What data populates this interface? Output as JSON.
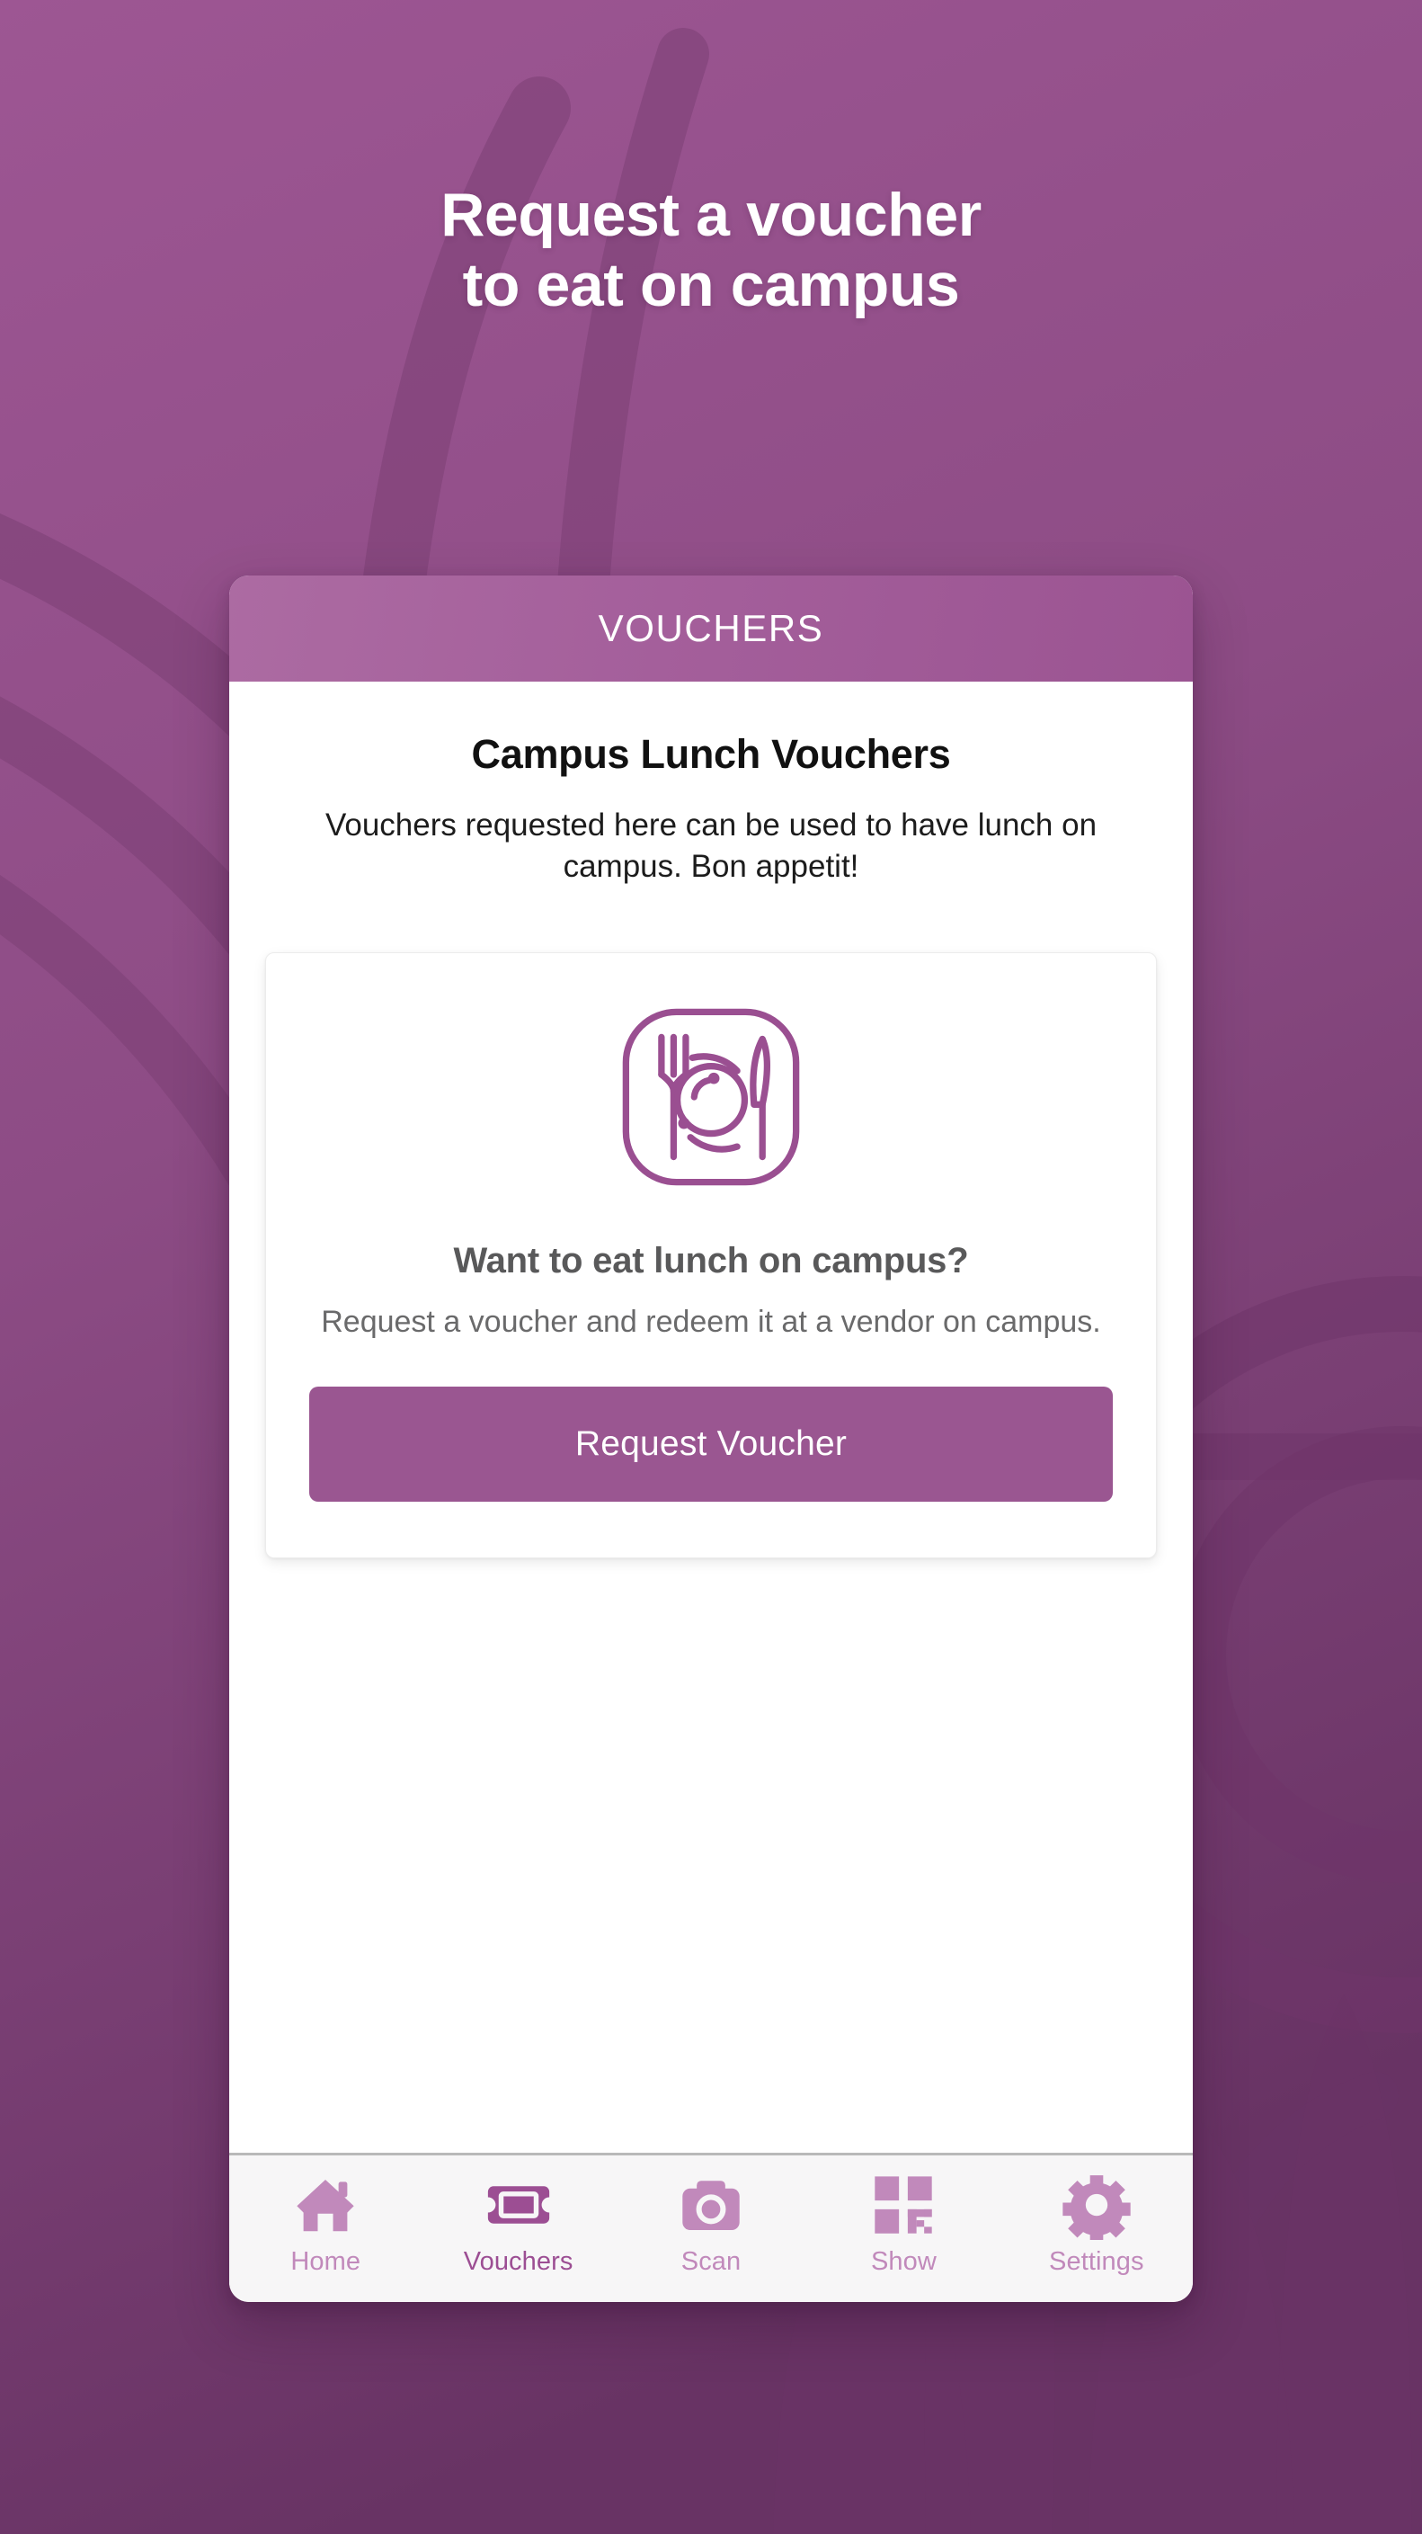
{
  "theme": {
    "brand_purple": "#9a5691",
    "header_gradient_light": "#ac6ba2",
    "header_gradient_dark": "#9b5492",
    "background_purple": "#8c4b84",
    "nav_inactive": "#c189bb",
    "nav_active": "#9c4e93",
    "card_white": "#ffffff",
    "nav_bar_bg": "#f7f6f7"
  },
  "heading": {
    "line1": "Request a voucher",
    "line2": "to eat on campus"
  },
  "card": {
    "header_title": "VOUCHERS",
    "section_title": "Campus Lunch Vouchers",
    "section_description": "Vouchers requested here can be used to have lunch on campus. Bon appetit!"
  },
  "inner_card": {
    "icon": "meal-plate-fork-knife-icon",
    "cta_title": "Want to eat lunch on campus?",
    "cta_description": "Request a voucher and redeem it at a vendor on campus.",
    "button_label": "Request Voucher"
  },
  "bottom_nav": {
    "active_index": 1,
    "items": [
      {
        "label": "Home",
        "icon": "home-icon"
      },
      {
        "label": "Vouchers",
        "icon": "ticket-icon"
      },
      {
        "label": "Scan",
        "icon": "camera-icon"
      },
      {
        "label": "Show",
        "icon": "qr-code-icon"
      },
      {
        "label": "Settings",
        "icon": "gear-icon"
      }
    ]
  }
}
